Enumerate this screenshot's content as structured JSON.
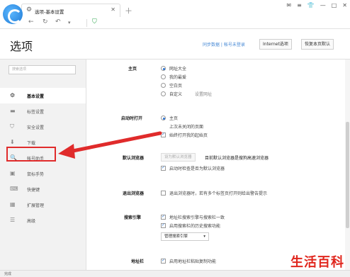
{
  "tab": {
    "title": "选项-基本设置"
  },
  "header": {
    "title": "选项",
    "sync_link": "同步数据 | 帐号未登录",
    "internet_options": "Internet选项",
    "restore_defaults": "恢复本页默认"
  },
  "sidebar": {
    "search_placeholder": "搜索选项",
    "items": [
      {
        "label": "基本设置",
        "icon": "gear-icon"
      },
      {
        "label": "标签设置",
        "icon": "tab-icon"
      },
      {
        "label": "安全设置",
        "icon": "shield-icon"
      },
      {
        "label": "下载",
        "icon": "download-icon"
      },
      {
        "label": "帐号助手",
        "icon": "key-icon"
      },
      {
        "label": "鼠标手势",
        "icon": "mouse-icon"
      },
      {
        "label": "快捷键",
        "icon": "keyboard-icon"
      },
      {
        "label": "扩展管理",
        "icon": "puzzle-icon"
      },
      {
        "label": "高级",
        "icon": "list-icon"
      }
    ]
  },
  "content": {
    "home": {
      "label": "主页",
      "options": [
        "网址大全",
        "我的最爱",
        "空白页",
        "自定义"
      ],
      "set_url": "设置网址"
    },
    "startup": {
      "label": "启动时打开",
      "options": [
        "主页",
        "上次未关闭的页面"
      ],
      "always_open": "始终打开我的起始页"
    },
    "default_browser": {
      "label": "默认浏览器",
      "button": "设为默认浏览器",
      "status": "目前默认浏览器是搜狗高速浏览器",
      "check": "启动时检查是否为默认浏览器"
    },
    "exit_browser": {
      "label": "退出浏览器",
      "option": "退出浏览器时，若有多个标签页打开则给出警告提示"
    },
    "search_engine": {
      "label": "搜索引擎",
      "opt1": "地址栏搜索引擎与搜索栏一致",
      "opt2": "启用搜索栏的历史搜索功能",
      "manage": "管理搜索引擎"
    },
    "address_bar": {
      "label": "地址栏",
      "opt1": "启用地址栏粘贴复制功能"
    }
  },
  "status": {
    "text": "完成"
  },
  "watermark": "生活百科",
  "colors": {
    "accent": "#2a72d0",
    "highlight": "#e02b2b"
  }
}
